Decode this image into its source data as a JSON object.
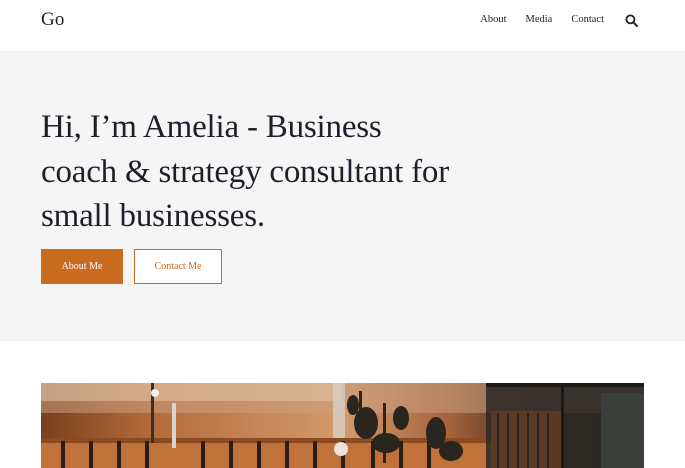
{
  "header": {
    "logo": "Go",
    "nav": [
      {
        "label": "About"
      },
      {
        "label": "Media"
      },
      {
        "label": "Contact"
      }
    ],
    "search_icon": "search-icon"
  },
  "hero": {
    "title": "Hi, I’m Amelia - Business coach & strategy consultant for small businesses.",
    "primary_button": "About Me",
    "secondary_button": "Contact Me"
  },
  "colors": {
    "accent": "#c86b1f",
    "hero_background": "#f5f5f5",
    "text": "#1f1f2b"
  }
}
